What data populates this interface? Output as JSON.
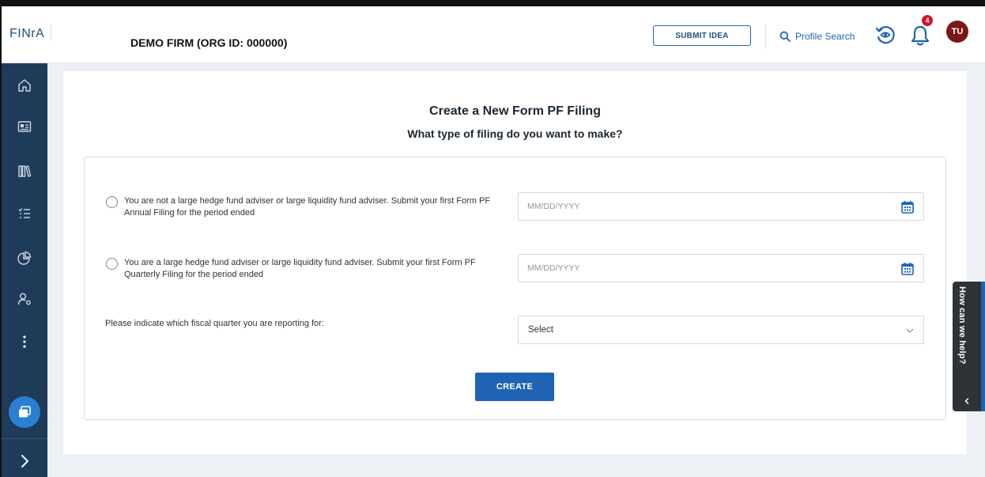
{
  "header": {
    "logo_text": "FINrA",
    "firm_name": "DEMO FIRM (ORG ID: 000000)",
    "submit_idea_label": "SUBMIT IDEA",
    "profile_search_label": "Profile Search",
    "notification_count": "4",
    "avatar_initials": "TU"
  },
  "sidebar": {
    "items": [
      {
        "icon": "home-icon"
      },
      {
        "icon": "id-card-icon"
      },
      {
        "icon": "library-icon"
      },
      {
        "icon": "checklist-icon"
      },
      {
        "icon": "pie-chart-icon"
      },
      {
        "icon": "user-settings-icon"
      },
      {
        "icon": "more-vertical-icon"
      }
    ],
    "fab_icon": "windows-icon",
    "expand_icon": "chevron-right-icon"
  },
  "form": {
    "title": "Create a New Form PF Filing",
    "subtitle": "What type of filing do you want to make?",
    "option_annual_text": "You are not a large hedge fund adviser or large liquidity fund adviser. Submit your first Form PF Annual Filing for the period ended",
    "option_quarterly_text": "You are a large hedge fund adviser or large liquidity fund adviser. Submit your first Form PF Quarterly Filing for the period ended",
    "annual_date_placeholder": "MM/DD/YYYY",
    "quarterly_date_placeholder": "MM/DD/YYYY",
    "quarter_label": "Please indicate which fiscal quarter you are reporting for:",
    "quarter_select_value": "Select",
    "create_label": "CREATE"
  },
  "help": {
    "label": "How can we help?"
  },
  "colors": {
    "primary": "#1e63b4",
    "sidebar": "#1f3b5a",
    "badge": "#d2112b",
    "avatar": "#7a1717"
  }
}
